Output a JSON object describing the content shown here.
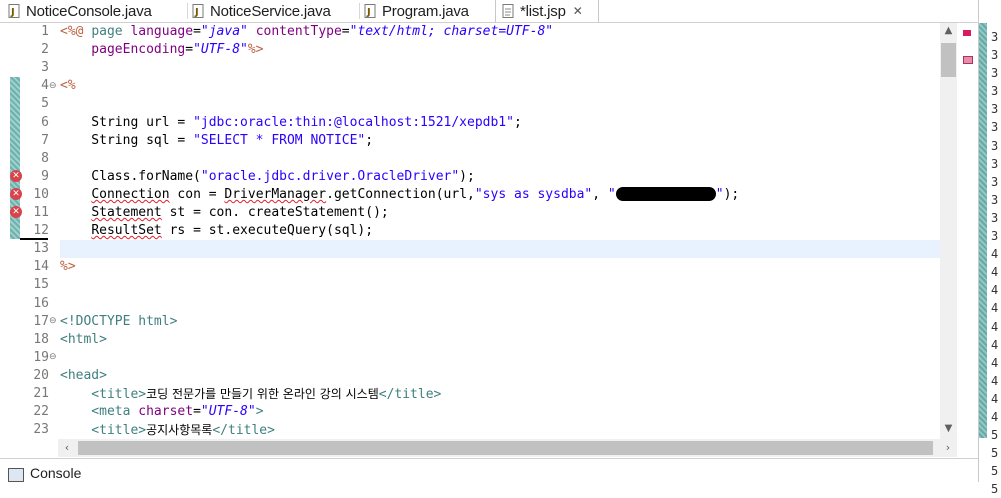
{
  "tabs": [
    {
      "label": "NoticeConsole.java",
      "active": false,
      "icon": "java-file-icon"
    },
    {
      "label": "NoticeService.java",
      "active": false,
      "icon": "java-file-icon"
    },
    {
      "label": "Program.java",
      "active": false,
      "icon": "java-file-icon"
    },
    {
      "label": "*list.jsp",
      "active": true,
      "icon": "jsp-file-icon",
      "close": "✕"
    }
  ],
  "editor": {
    "line_numbers": [
      "1",
      "2",
      "3",
      "4",
      "5",
      "6",
      "7",
      "8",
      "9",
      "10",
      "11",
      "12",
      "13",
      "14",
      "15",
      "16",
      "17",
      "18",
      "19",
      "20",
      "21",
      "22",
      "23"
    ],
    "lines": {
      "l1_a": "<%@ ",
      "l1_b": "page ",
      "l1_c": "language",
      "l1_d": "=",
      "l1_e": "\"java\"",
      "l1_f": " contentType",
      "l1_g": "=",
      "l1_h": "\"text/html; charset=UTF-8\"",
      "l2_a": "    pageEncoding",
      "l2_b": "=",
      "l2_c": "\"UTF-8\"",
      "l2_d": "%>",
      "l4": "<%",
      "l5_a": "    String url = ",
      "l5_b": "\"jdbc:oracle:thin:@localhost:1521/xepdb1\"",
      "l5_c": ";",
      "l6_a": "    String sql = ",
      "l6_b": "\"SELECT * FROM NOTICE\"",
      "l6_c": ";",
      "l8_a": "    Class.forName(",
      "l8_b": "\"oracle.jdbc.driver.OracleDriver\"",
      "l8_c": ");",
      "l9_a": "Connection",
      "l9_b": " con = ",
      "l9_c": "DriverManager",
      "l9_d": ".getConnection(url,",
      "l9_e": "\"sys as sysdba\"",
      "l9_f": ", ",
      "l9_g": "\"",
      "l9_h": "\"",
      "l9_i": ");",
      "l10_a": "Statement",
      "l10_b": " st = con. createStatement();",
      "l11_a": "ResultSet",
      "l11_b": " rs = st.executeQuery(sql);",
      "l13": "%>",
      "l16": "<!DOCTYPE html>",
      "l17": "<html>",
      "l19": "<head>",
      "l20_a": "    <title>",
      "l20_b": "코딩 전문가를 만들기 위한 온라인 강의 시스템",
      "l20_c": "</title>",
      "l21_a": "    <meta ",
      "l21_b": "charset",
      "l21_c": "=",
      "l21_d": "\"UTF-8\"",
      "l21_e": ">",
      "l22_a": "    <title>",
      "l22_b": "공지사항목록",
      "l22_c": "</title>"
    },
    "error_lines": [
      "9",
      "10",
      "11"
    ],
    "current_line": "12"
  },
  "right_strip": {
    "digits": [
      "3",
      "3",
      "3",
      "3",
      "3",
      "3",
      "3",
      "3",
      "3",
      "3",
      "3",
      "3",
      "4",
      "4",
      "4",
      "4",
      "4",
      "4",
      "4",
      "4",
      "4",
      "4",
      "5",
      "5",
      "5",
      "5"
    ]
  },
  "bottom": {
    "console_label": "Console"
  },
  "colors": {
    "error": "#d9434b",
    "current_line": "#e8f2fe",
    "string": "#2a00ff",
    "tag": "#3f7f7f",
    "attribute": "#7f007f"
  }
}
